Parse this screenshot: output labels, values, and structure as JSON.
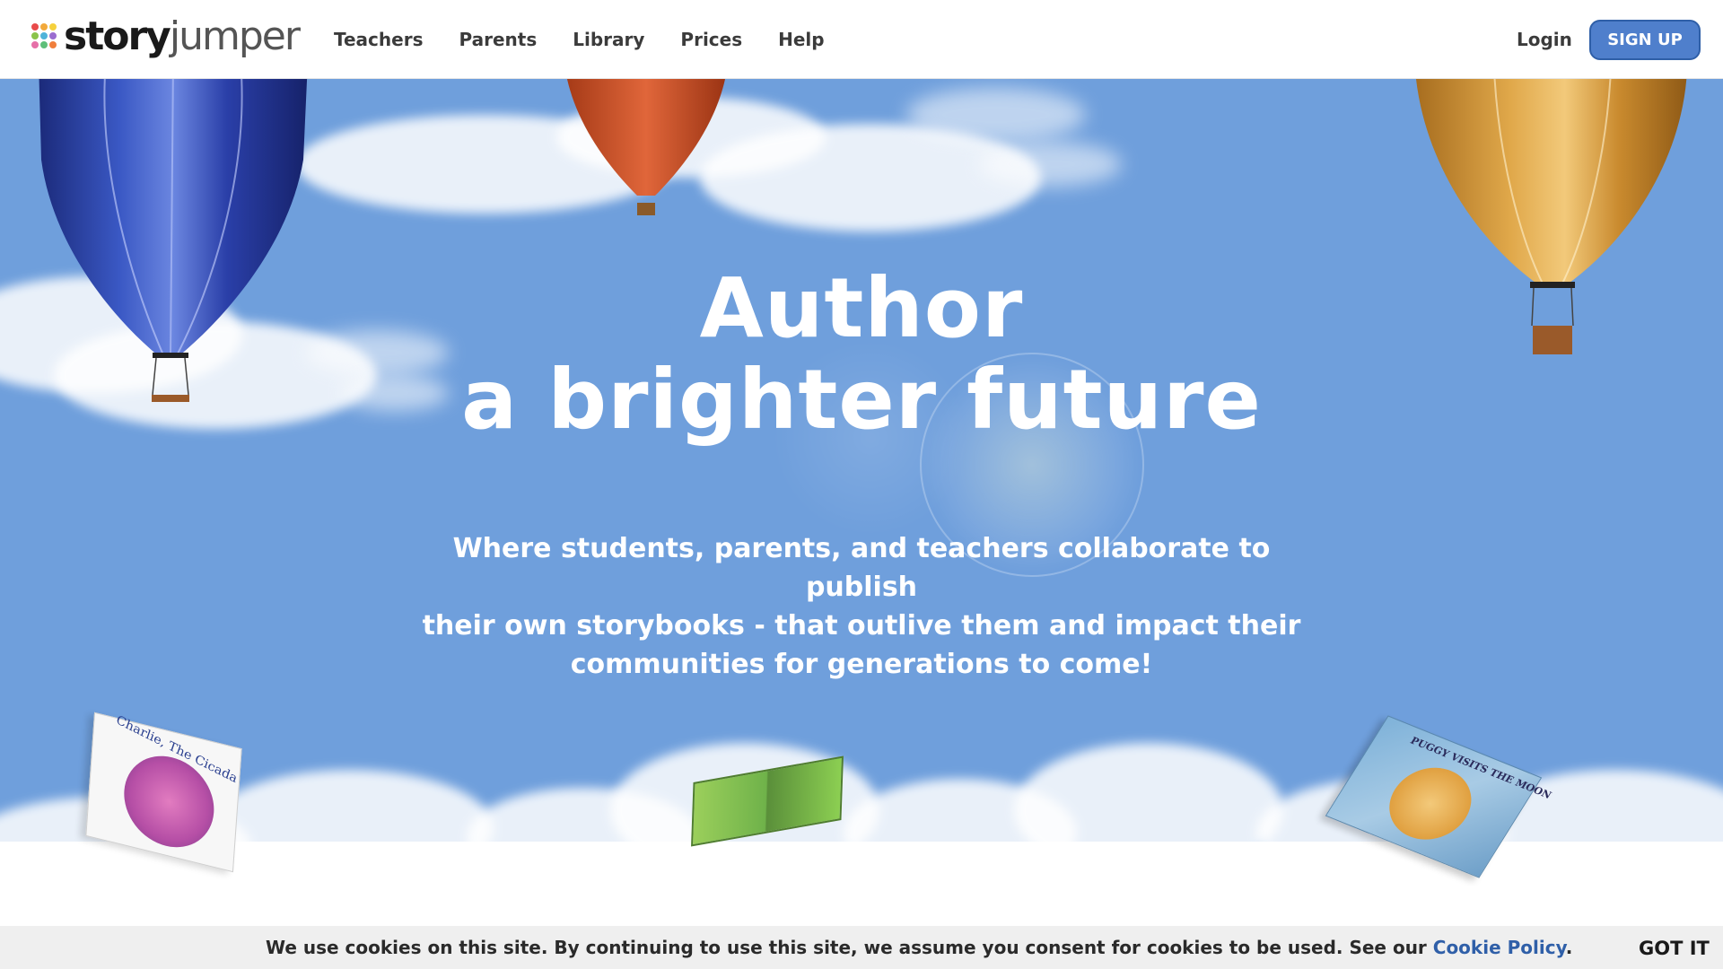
{
  "header": {
    "logo": {
      "part1": "story",
      "part2": "jumper"
    },
    "nav": [
      {
        "label": "Teachers"
      },
      {
        "label": "Parents"
      },
      {
        "label": "Library"
      },
      {
        "label": "Prices"
      },
      {
        "label": "Help"
      }
    ],
    "login_label": "Login",
    "signup_label": "SIGN UP"
  },
  "hero": {
    "title_line1": "Author",
    "title_line2": "a brighter future",
    "subtitle_line1": "Where students, parents, and teachers collaborate to publish",
    "subtitle_line2": "their own storybooks - that outlive them and impact their",
    "subtitle_line3": "communities for generations to come!",
    "books": [
      {
        "cover_text": "Charlie, The Cicada"
      },
      {
        "cover_text": ""
      },
      {
        "cover_text": "PUGGY VISITS THE MOON"
      }
    ]
  },
  "cookie_bar": {
    "text": "We use cookies on this site. By continuing to use this site, we assume you consent for cookies to be used. See our ",
    "link_label": "Cookie Policy",
    "period": ".",
    "button_label": "GOT IT"
  },
  "colors": {
    "sky": "#6f9fdc",
    "brand_button": "#4f7fcc",
    "link": "#2f5fa8",
    "cookie_bg": "#efefef"
  }
}
